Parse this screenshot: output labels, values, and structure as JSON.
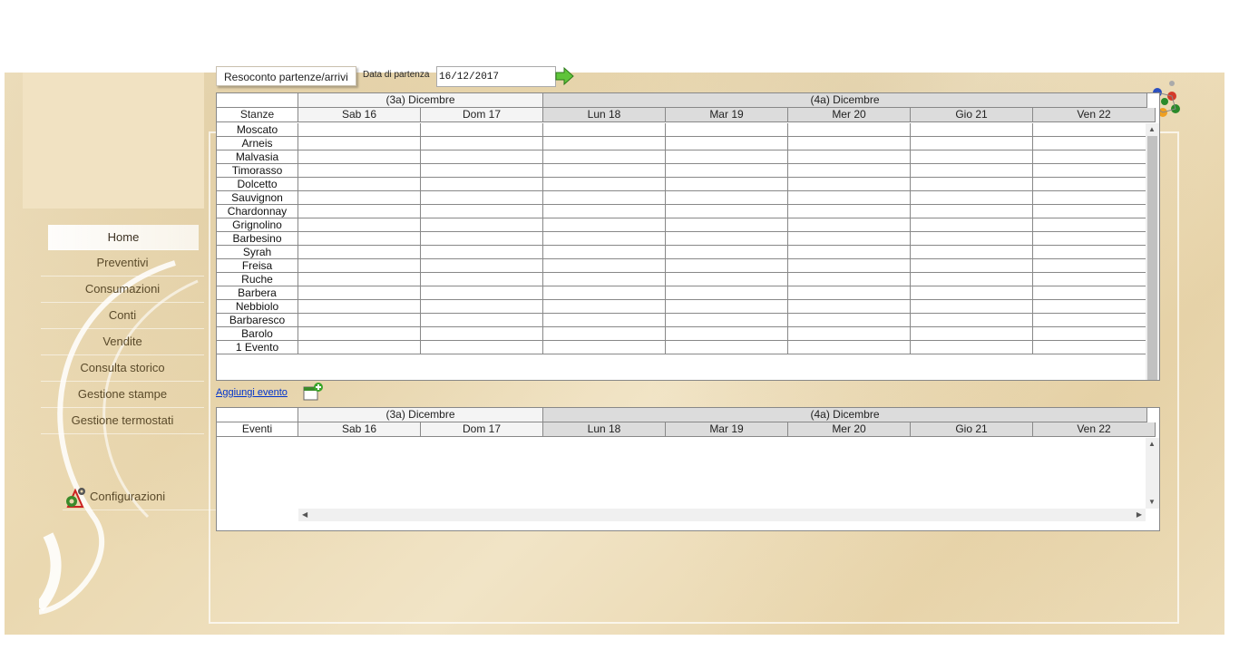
{
  "menu": {
    "items": [
      {
        "label": "Home",
        "active": true
      },
      {
        "label": "Preventivi"
      },
      {
        "label": "Consumazioni"
      },
      {
        "label": "Conti"
      },
      {
        "label": "Vendite"
      },
      {
        "label": "Consulta storico"
      },
      {
        "label": "Gestione stampe"
      },
      {
        "label": "Gestione termostati"
      }
    ],
    "config_label": "Configurazioni"
  },
  "toolbar": {
    "report_button": "Resoconto partenze/arrivi",
    "date_label": "Data di partenza",
    "date_value": "16/12/2017"
  },
  "weeks": [
    "(3a) Dicembre",
    "(4a) Dicembre"
  ],
  "days": [
    "Sab 16",
    "Dom 17",
    "Lun 18",
    "Mar 19",
    "Mer 20",
    "Gio 21",
    "Ven 22"
  ],
  "rooms_grid": {
    "header": "Stanze",
    "rows": [
      "Moscato",
      "Arneis",
      "Malvasia",
      "Timorasso",
      "Dolcetto",
      "Sauvignon",
      "Chardonnay",
      "Grignolino",
      "Barbesino",
      "Syrah",
      "Freisa",
      "Ruche",
      "Barbera",
      "Nebbiolo",
      "Barbaresco",
      "Barolo",
      "1 Evento"
    ]
  },
  "events_grid": {
    "header": "Eventi"
  },
  "add_event_link": "Aggiungi evento",
  "colors": {
    "background": "#ecdcb8",
    "week_a": "#f4f4f4",
    "week_b": "#dcdcdc",
    "link": "#0033cc"
  }
}
